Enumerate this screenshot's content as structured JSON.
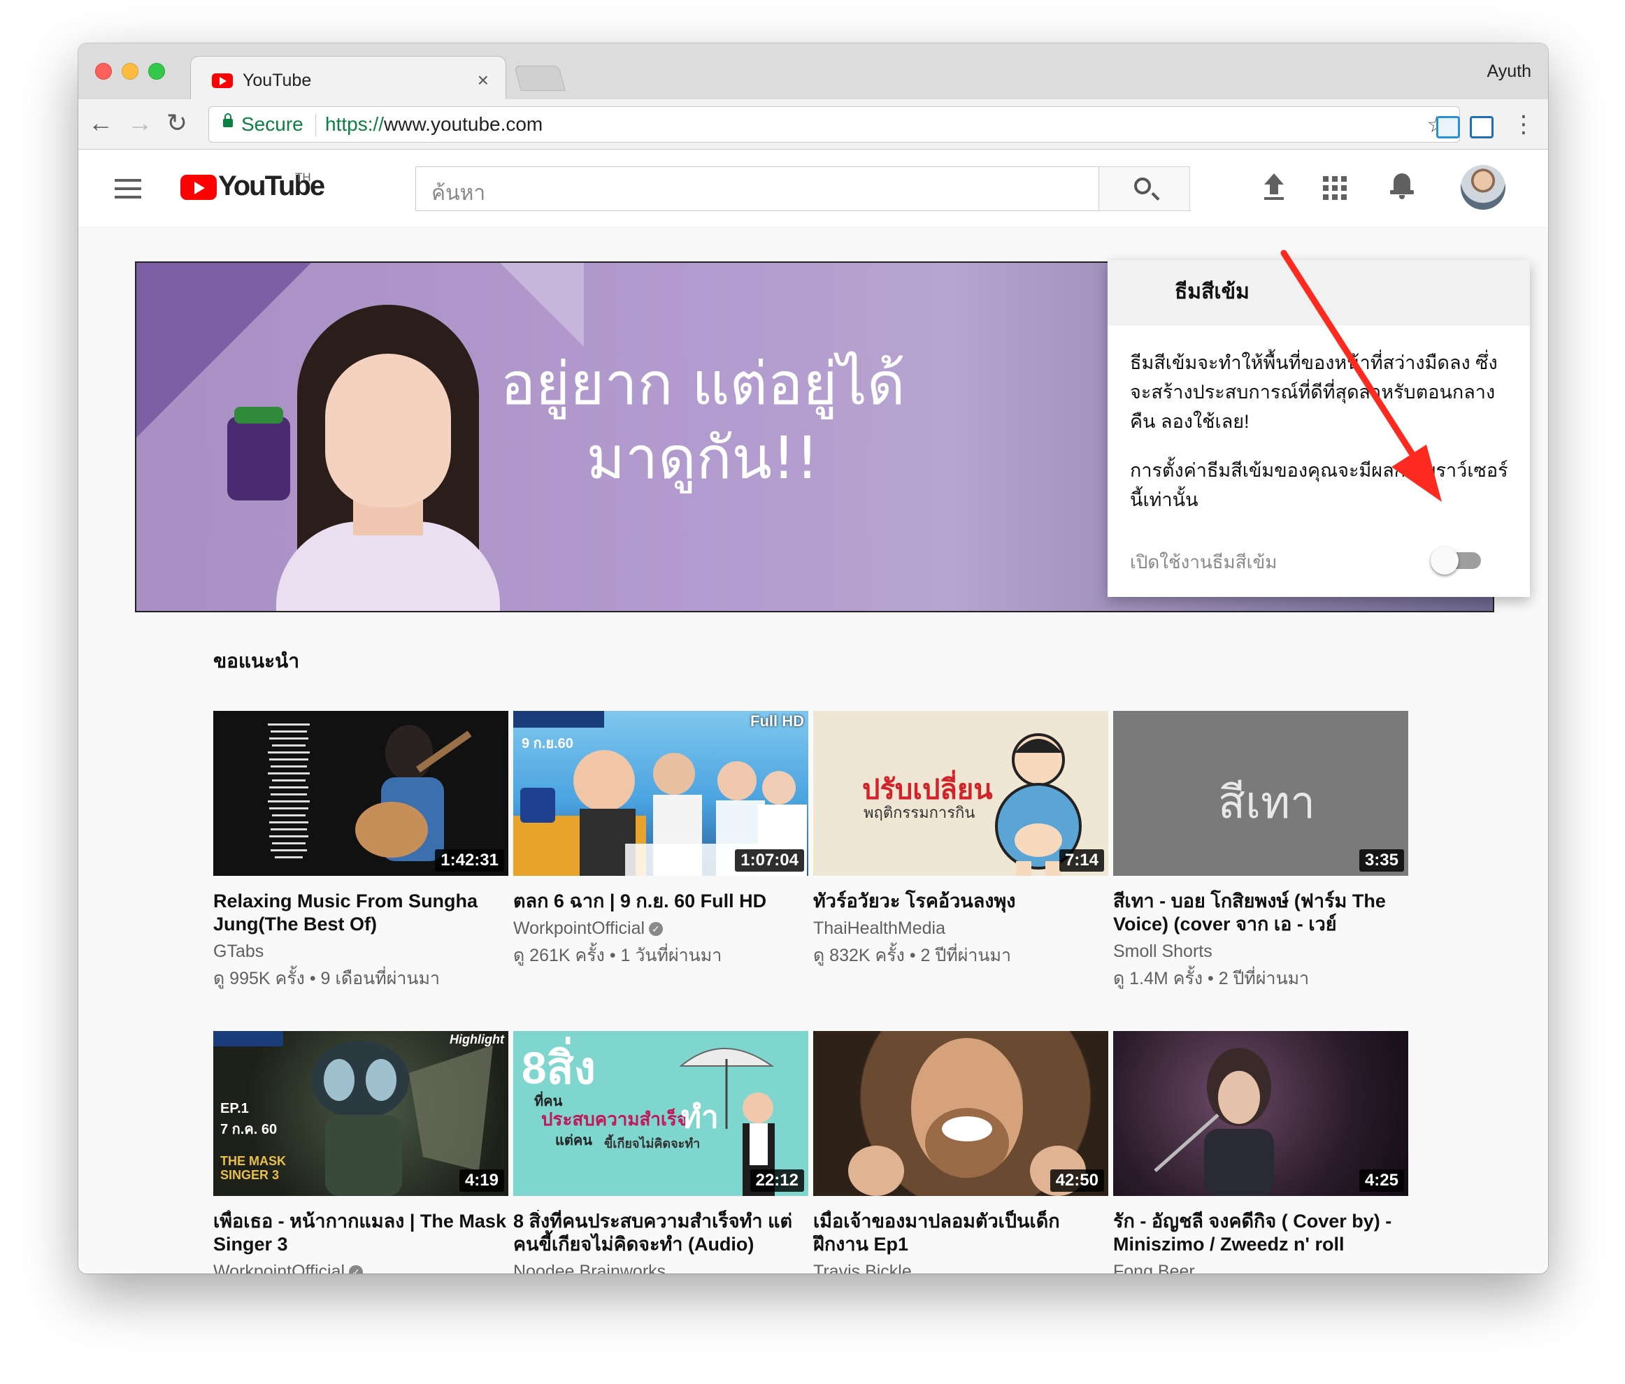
{
  "browser": {
    "tab_title": "YouTube",
    "tab_close": "×",
    "profile_name": "Ayuth",
    "secure_label": "Secure",
    "url_scheme": "https://",
    "url_rest": "www.youtube.com",
    "back": "←",
    "forward": "→",
    "reload": "↻",
    "star": "☆",
    "menu": "⋮",
    "icons": [
      "back-icon",
      "forward-icon",
      "reload-icon",
      "lock-icon",
      "star-icon",
      "extension-icon",
      "menu-icon"
    ]
  },
  "youtube": {
    "logo_text": "YouTube",
    "logo_country": "TH",
    "search_placeholder": "ค้นหา",
    "banner_text_line1": "อยู่ยาก แต่อยู่ได้",
    "banner_text_line2": "มาดูกัน!!",
    "section_title": "ขอแนะนำ",
    "brand_color": "#ff0000"
  },
  "videos": [
    {
      "title": "Relaxing Music From Sungha Jung(The Best Of)",
      "channel": "GTabs",
      "verified": false,
      "meta": "ดู 995K ครั้ง • 9 เดือนที่ผ่านมา",
      "duration": "1:42:31"
    },
    {
      "title": "ตลก 6 ฉาก | 9 ก.ย. 60 Full HD",
      "channel": "WorkpointOfficial",
      "verified": true,
      "meta": "ดู 261K ครั้ง • 1 วันที่ผ่านมา",
      "duration": "1:07:04",
      "overlay_date": "9 ก.ย.60",
      "overlay_tag": "Full HD"
    },
    {
      "title": "ทัวร์อวัยวะ โรคอ้วนลงพุง",
      "channel": "ThaiHealthMedia",
      "verified": false,
      "meta": "ดู 832K ครั้ง • 2 ปีที่ผ่านมา",
      "duration": "7:14",
      "overlay_big": "ปรับเปลี่ยน",
      "overlay_small": "พฤติกรรมการกิน"
    },
    {
      "title": "สีเทา - บอย โกสิยพงษ์ (ฟาร์ม The Voice) (cover จาก เอ - เวย์",
      "channel": "Smoll Shorts",
      "verified": false,
      "meta": "ดู 1.4M ครั้ง • 2 ปีที่ผ่านมา",
      "duration": "3:35",
      "overlay_big": "สีเทา"
    },
    {
      "title": "เพื่อเธอ - หน้ากากแมลง | The Mask Singer 3",
      "channel": "WorkpointOfficial",
      "verified": true,
      "duration": "4:19",
      "overlay_tag": "Highlight",
      "overlay_ep": "EP.1",
      "overlay_date": "7 ก.ค. 60",
      "overlay_show": "THE MASK SINGER 3"
    },
    {
      "title": "8 สิ่งที่คนประสบความสำเร็จทำ แต่คนขี้เกียจไม่คิดจะทำ (Audio)",
      "channel": "Noodee Brainworks",
      "verified": false,
      "duration": "22:12",
      "overlay_big": "8สิ่ง",
      "overlay_small": "ที่คน",
      "overlay_line": "ประสบความสำเร็จ",
      "overlay_do": "ทำ",
      "overlay_lazy": "แต่คน",
      "overlay_lazy2": "ขี้เกียจไม่คิดจะทำ"
    },
    {
      "title": "เมื่อเจ้าของมาปลอมตัวเป็นเด็กฝึกงาน Ep1",
      "channel": "Travis Bickle",
      "verified": false,
      "duration": "42:50"
    },
    {
      "title": "รัก - อัญชลี จงคดีกิจ ( Cover by) - Miniszimo / Zweedz n' roll",
      "channel": "Fong Beer",
      "verified": false,
      "duration": "4:25"
    }
  ],
  "dark_theme_popup": {
    "title": "ธีมสีเข้ม",
    "body1": "ธีมสีเข้มจะทำให้พื้นที่ของหน้าที่สว่างมืดลง ซึ่งจะสร้างประสบการณ์ที่ดีที่สุดสำหรับตอนกลางคืน ลองใช้เลย!",
    "body2": "การตั้งค่าธีมสีเข้มของคุณจะมีผลกับเบราว์เซอร์นี้เท่านั้น",
    "toggle_label": "เปิดใช้งานธีมสีเข้ม",
    "toggle_on": false
  },
  "annotation": {
    "arrow_color": "#ff2a1f"
  }
}
